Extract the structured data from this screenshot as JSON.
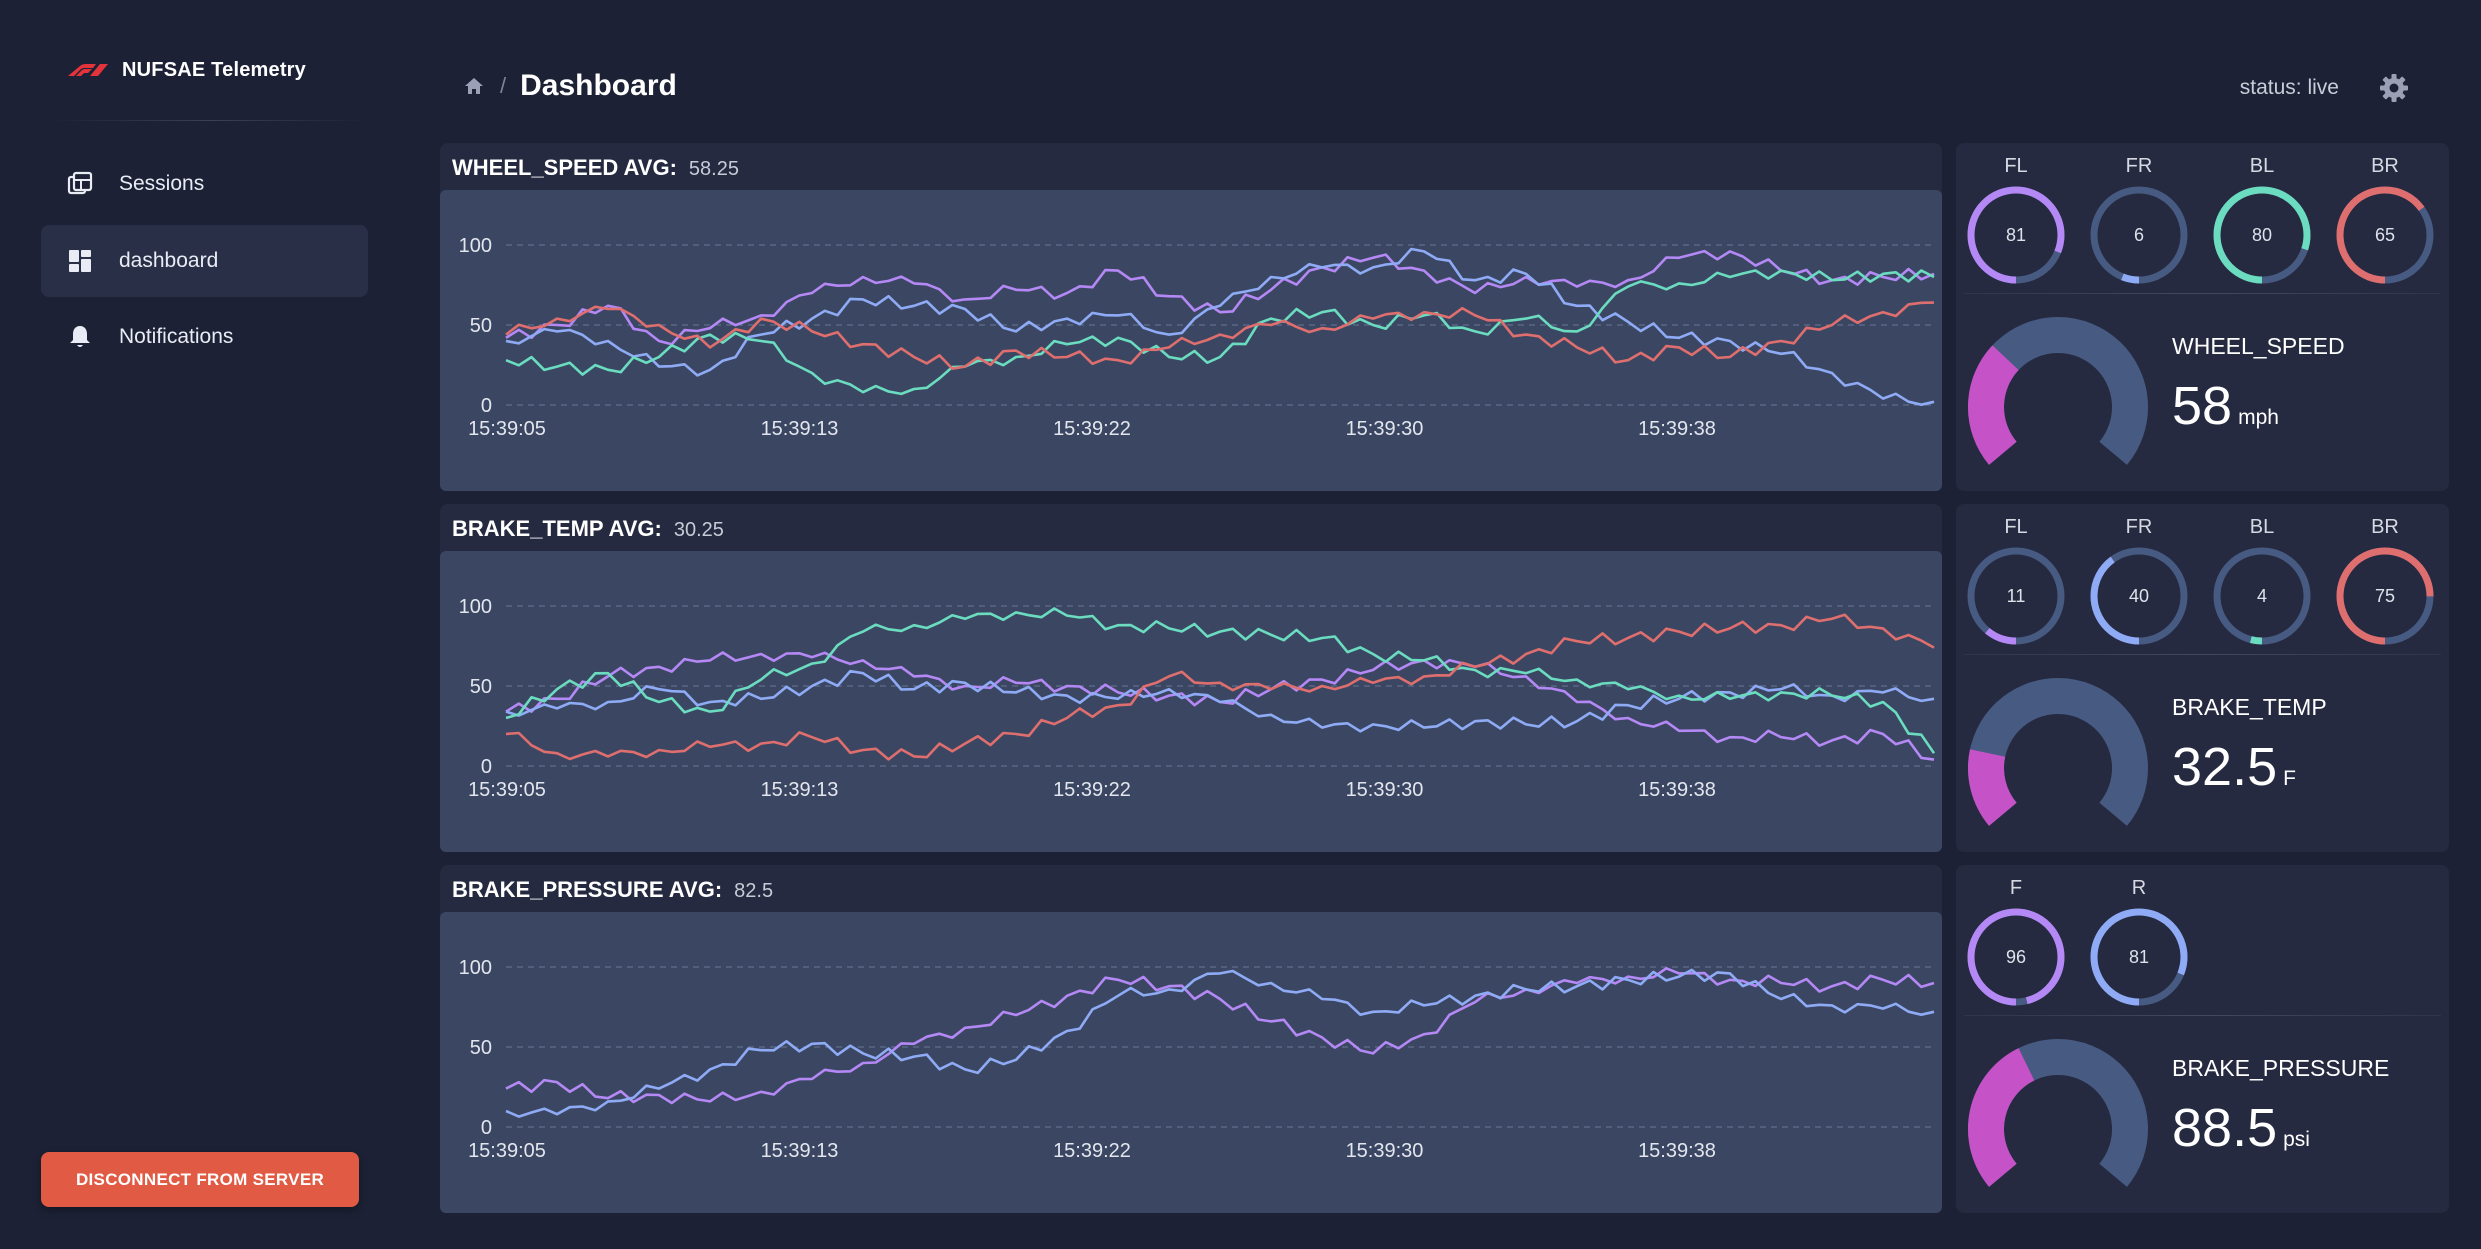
{
  "app": {
    "title": "NUFSAE Telemetry"
  },
  "sidebar": {
    "items": [
      {
        "label": "Sessions",
        "icon": "sessions-icon"
      },
      {
        "label": "dashboard",
        "icon": "dashboard-icon",
        "active": true
      },
      {
        "label": "Notifications",
        "icon": "bell-icon"
      }
    ],
    "disconnect_label": "DISCONNECT FROM SERVER"
  },
  "header": {
    "breadcrumb_separator": "/",
    "title": "Dashboard",
    "status": "status: live"
  },
  "colors": {
    "purple": "#b488f5",
    "blue": "#8fabf6",
    "teal": "#6bdcc0",
    "red": "#df6e6e",
    "magenta": "#c552c6",
    "track": "#475a82"
  },
  "panels": [
    {
      "title": "WHEEL_SPEED AVG:",
      "avg": "58.25",
      "chart_data": {
        "type": "line",
        "x_ticks": [
          "15:39:05",
          "15:39:13",
          "15:39:22",
          "15:39:30",
          "15:39:38"
        ],
        "y_ticks": [
          "0",
          "50",
          "100"
        ],
        "ylim": [
          0,
          100
        ],
        "series": [
          {
            "color": "#b488f5",
            "values": [
              42,
              50,
              62,
              40,
              48,
              56,
              70,
              80,
              76,
              66,
              72,
              70,
              84,
              68,
              58,
              72,
              86,
              92,
              84,
              70,
              80,
              74,
              78,
              92,
              96,
              84,
              78,
              80,
              82
            ]
          },
          {
            "color": "#8fabf6",
            "values": [
              40,
              46,
              40,
              24,
              22,
              44,
              54,
              66,
              62,
              60,
              46,
              54,
              56,
              44,
              62,
              80,
              86,
              86,
              96,
              78,
              82,
              62,
              52,
              42,
              40,
              32,
              20,
              4,
              2
            ]
          },
          {
            "color": "#6bdcc0",
            "values": [
              28,
              24,
              22,
              30,
              44,
              40,
              20,
              8,
              10,
              24,
              30,
              38,
              42,
              30,
              30,
              54,
              58,
              50,
              56,
              46,
              54,
              46,
              74,
              76,
              80,
              84,
              78,
              82,
              80
            ]
          },
          {
            "color": "#df6e6e",
            "values": [
              44,
              54,
              60,
              50,
              36,
              54,
              46,
              38,
              30,
              24,
              34,
              30,
              28,
              36,
              44,
              50,
              48,
              54,
              58,
              56,
              44,
              36,
              28,
              36,
              30,
              40,
              50,
              58,
              64
            ]
          }
        ]
      },
      "gauges": {
        "rings": [
          {
            "label": "FL",
            "value": 81,
            "color": "#b488f5"
          },
          {
            "label": "FR",
            "value": 6,
            "color": "#8fabf6"
          },
          {
            "label": "BL",
            "value": 80,
            "color": "#6bdcc0"
          },
          {
            "label": "BR",
            "value": 65,
            "color": "#df6e6e"
          }
        ],
        "big": {
          "name": "WHEEL_SPEED",
          "value": "58",
          "unit": "mph",
          "level": 0.32
        }
      }
    },
    {
      "title": "BRAKE_TEMP AVG:",
      "avg": "30.25",
      "chart_data": {
        "type": "line",
        "x_ticks": [
          "15:39:05",
          "15:39:13",
          "15:39:22",
          "15:39:30",
          "15:39:38"
        ],
        "y_ticks": [
          "0",
          "50",
          "100"
        ],
        "ylim": [
          0,
          100
        ],
        "series": [
          {
            "color": "#b488f5",
            "values": [
              34,
              42,
              56,
              62,
              66,
              70,
              68,
              66,
              56,
              50,
              52,
              50,
              46,
              44,
              40,
              48,
              54,
              60,
              66,
              62,
              56,
              40,
              30,
              22,
              18,
              18,
              16,
              20,
              4
            ]
          },
          {
            "color": "#8fabf6",
            "values": [
              34,
              36,
              40,
              48,
              40,
              42,
              50,
              58,
              48,
              52,
              46,
              44,
              42,
              48,
              40,
              32,
              24,
              26,
              24,
              28,
              26,
              28,
              38,
              42,
              46,
              48,
              44,
              46,
              42
            ]
          },
          {
            "color": "#6bdcc0",
            "values": [
              30,
              48,
              58,
              40,
              34,
              54,
              64,
              84,
              88,
              92,
              96,
              94,
              88,
              86,
              84,
              82,
              80,
              70,
              66,
              60,
              58,
              54,
              48,
              44,
              42,
              46,
              44,
              40,
              8
            ]
          },
          {
            "color": "#df6e6e",
            "values": [
              20,
              8,
              6,
              10,
              12,
              14,
              18,
              10,
              6,
              14,
              20,
              30,
              38,
              56,
              52,
              48,
              50,
              52,
              56,
              62,
              70,
              78,
              80,
              84,
              86,
              88,
              92,
              86,
              74
            ]
          }
        ]
      },
      "gauges": {
        "rings": [
          {
            "label": "FL",
            "value": 11,
            "color": "#b488f5"
          },
          {
            "label": "FR",
            "value": 40,
            "color": "#8fabf6"
          },
          {
            "label": "BL",
            "value": 4,
            "color": "#6bdcc0"
          },
          {
            "label": "BR",
            "value": 75,
            "color": "#df6e6e"
          }
        ],
        "big": {
          "name": "BRAKE_TEMP",
          "value": "32.5",
          "unit": "F",
          "level": 0.2
        }
      }
    },
    {
      "title": "BRAKE_PRESSURE AVG:",
      "avg": "82.5",
      "chart_data": {
        "type": "line",
        "x_ticks": [
          "15:39:05",
          "15:39:13",
          "15:39:22",
          "15:39:30",
          "15:39:38"
        ],
        "y_ticks": [
          "0",
          "50",
          "100"
        ],
        "ylim": [
          0,
          100
        ],
        "series": [
          {
            "color": "#b488f5",
            "values": [
              24,
              28,
              18,
              20,
              16,
              22,
              30,
              40,
              52,
              62,
              70,
              82,
              92,
              88,
              80,
              66,
              56,
              46,
              58,
              78,
              86,
              90,
              94,
              96,
              92,
              90,
              88,
              92,
              90
            ]
          },
          {
            "color": "#8fabf6",
            "values": [
              10,
              8,
              16,
              24,
              36,
              48,
              52,
              46,
              44,
              36,
              42,
              60,
              82,
              86,
              96,
              90,
              80,
              72,
              76,
              82,
              86,
              88,
              92,
              94,
              96,
              80,
              76,
              74,
              72
            ]
          }
        ]
      },
      "gauges": {
        "rings": [
          {
            "label": "F",
            "value": 96,
            "color": "#b488f5"
          },
          {
            "label": "R",
            "value": 81,
            "color": "#8fabf6"
          }
        ],
        "big": {
          "name": "BRAKE_PRESSURE",
          "value": "88.5",
          "unit": "psi",
          "level": 0.4
        }
      }
    }
  ]
}
